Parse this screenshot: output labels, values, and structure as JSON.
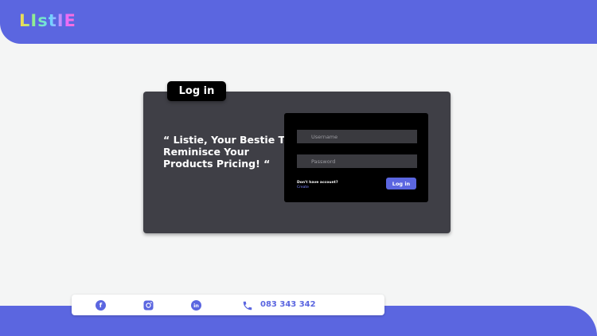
{
  "header": {
    "logo_text": "LIstIE"
  },
  "login_tab": {
    "label": "Log in"
  },
  "slogan": "“ Listie, Your Bestie To Reminisce Your Products Pricing! “",
  "form": {
    "username_placeholder": "Username",
    "password_placeholder": "Password",
    "signup_prompt": "Don't have account?",
    "create_link": "Create",
    "login_button": "Log in"
  },
  "footer": {
    "socials": [
      "facebook-icon",
      "instagram-icon",
      "linkedin-icon"
    ],
    "phone_number": "083 343 342"
  },
  "colors": {
    "primary": "#5b66e0",
    "card": "#3f3f46",
    "form_bg": "#000000",
    "background": "#f4f5f5"
  }
}
